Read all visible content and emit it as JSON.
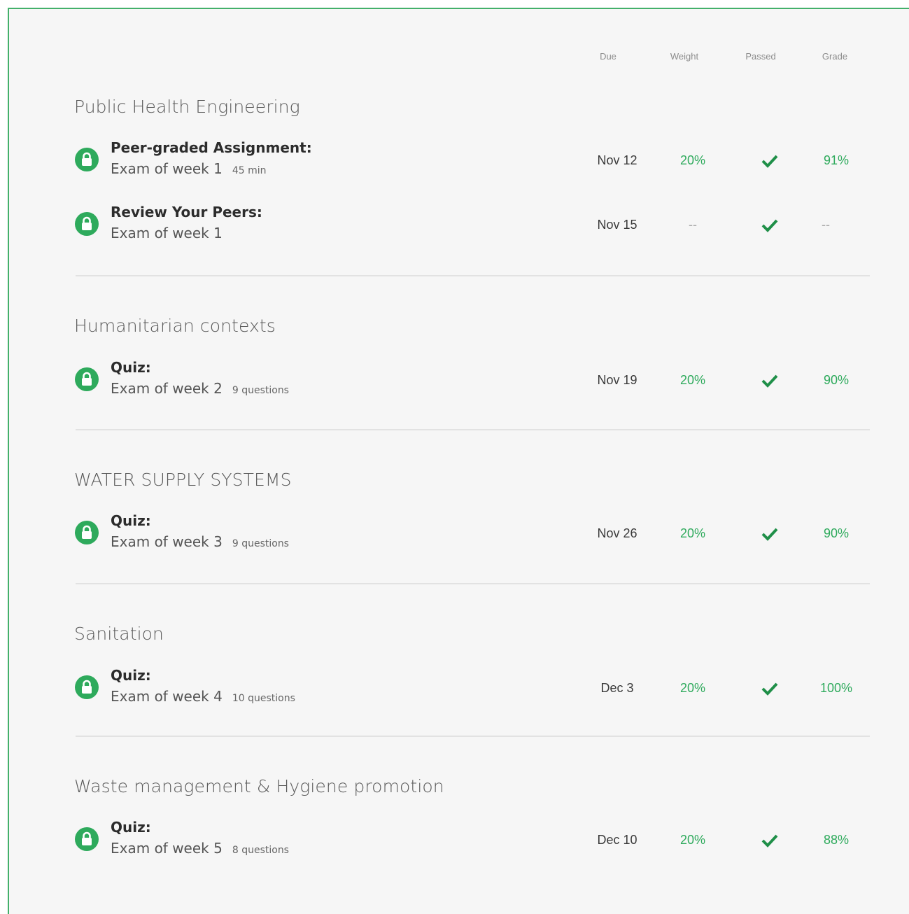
{
  "columns": {
    "due": "Due",
    "weight": "Weight",
    "passed": "Passed",
    "grade": "Grade"
  },
  "sections": [
    {
      "title": "Public Health Engineering",
      "items": [
        {
          "type": "Peer-graded Assignment:",
          "name": "Exam of week 1",
          "meta": "45 min",
          "due": "Nov 12",
          "weight": "20%",
          "passed": true,
          "grade": "91%"
        },
        {
          "type": "Review Your Peers:",
          "name": "Exam of week 1",
          "meta": "",
          "due": "Nov 15",
          "weight": "--",
          "passed": true,
          "grade": "--"
        }
      ]
    },
    {
      "title": "Humanitarian contexts",
      "items": [
        {
          "type": "Quiz:",
          "name": "Exam of week 2",
          "meta": "9 questions",
          "due": "Nov 19",
          "weight": "20%",
          "passed": true,
          "grade": "90%"
        }
      ]
    },
    {
      "title": "WATER SUPPLY SYSTEMS",
      "items": [
        {
          "type": "Quiz:",
          "name": "Exam of week 3",
          "meta": "9 questions",
          "due": "Nov 26",
          "weight": "20%",
          "passed": true,
          "grade": "90%"
        }
      ]
    },
    {
      "title": "Sanitation",
      "items": [
        {
          "type": "Quiz:",
          "name": "Exam of week 4",
          "meta": "10 questions",
          "due": "Dec 3",
          "weight": "20%",
          "passed": true,
          "grade": "100%"
        }
      ]
    },
    {
      "title": "Waste management & Hygiene promotion",
      "items": [
        {
          "type": "Quiz:",
          "name": "Exam of week 5",
          "meta": "8 questions",
          "due": "Dec 10",
          "weight": "20%",
          "passed": true,
          "grade": "88%"
        }
      ]
    }
  ],
  "icons": {
    "item": "lock-icon",
    "passed": "checkmark-icon"
  },
  "colors": {
    "accent": "#2eaa5c",
    "border": "#43b06a"
  }
}
